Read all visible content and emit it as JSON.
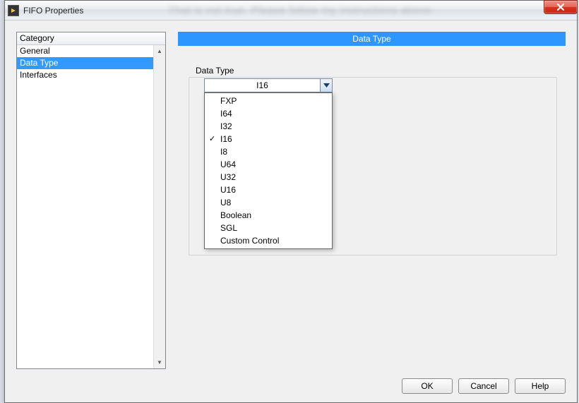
{
  "window": {
    "title": "FIFO Properties",
    "blurred_bg_text": "That is not true. Please follow my instructions above."
  },
  "sidebar": {
    "header": "Category",
    "items": [
      "General",
      "Data Type",
      "Interfaces"
    ],
    "selected_index": 1
  },
  "panel": {
    "title": "Data Type"
  },
  "field": {
    "label": "Data Type",
    "selected": "I16",
    "options": [
      "FXP",
      "I64",
      "I32",
      "I16",
      "I8",
      "U64",
      "U32",
      "U16",
      "U8",
      "Boolean",
      "SGL",
      "Custom Control"
    ]
  },
  "buttons": {
    "ok": "OK",
    "cancel": "Cancel",
    "help": "Help"
  }
}
